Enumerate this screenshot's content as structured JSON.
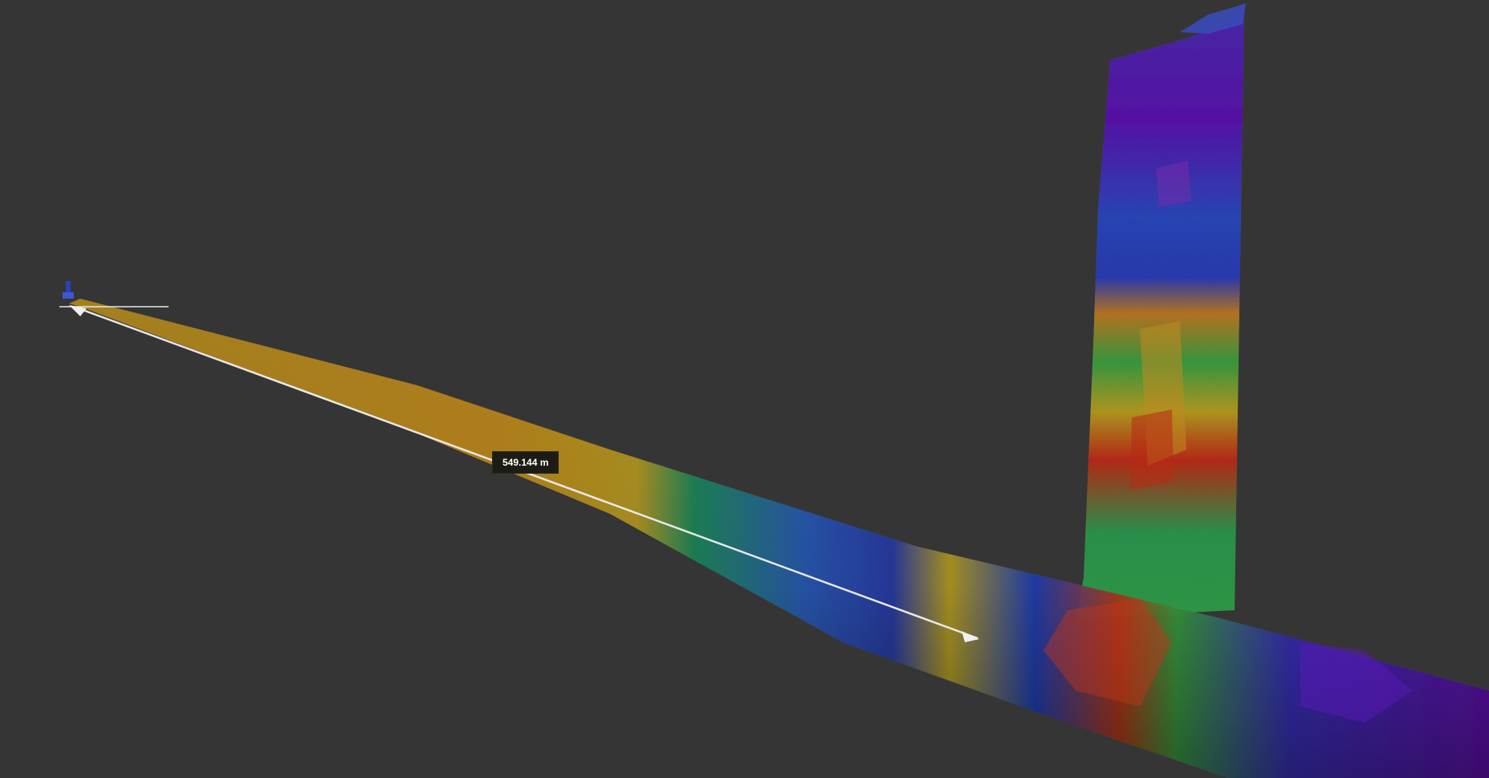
{
  "viewer": {
    "background_color": "#353535"
  },
  "measurement": {
    "distance_label": "549.144 m",
    "line_color": "#e8e8e8",
    "label_background": "#1c1c14"
  },
  "point_cloud": {
    "colormap": [
      "#6a00b8",
      "#2a3cc8",
      "#0f8a4a",
      "#3aa83a",
      "#b8a020",
      "#c88a18",
      "#c02810"
    ],
    "objects": [
      "pipeline",
      "vertical-stack"
    ]
  }
}
